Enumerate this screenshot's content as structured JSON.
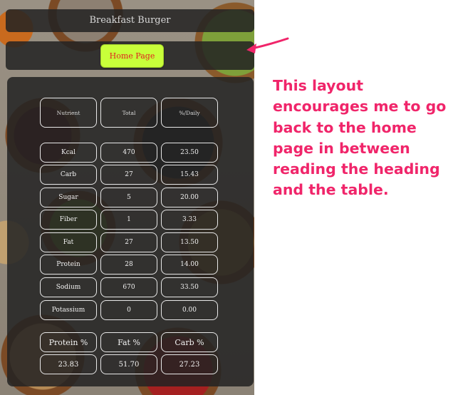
{
  "header": {
    "title": "Breakfast Burger"
  },
  "nav": {
    "home_label": "Home Page"
  },
  "table": {
    "headers": [
      "Nutrient",
      "Total",
      "%/Daily"
    ],
    "rows": [
      [
        "Kcal",
        "470",
        "23.50"
      ],
      [
        "Carb",
        "27",
        "15.43"
      ],
      [
        "Sugar",
        "5",
        "20.00"
      ],
      [
        "Fiber",
        "1",
        "3.33"
      ],
      [
        "Fat",
        "27",
        "13.50"
      ],
      [
        "Protein",
        "28",
        "14.00"
      ],
      [
        "Sodium",
        "670",
        "33.50"
      ],
      [
        "Potassium",
        "0",
        "0.00"
      ]
    ]
  },
  "summary": {
    "headers": [
      "Protein %",
      "Fat %",
      "Carb %"
    ],
    "values": [
      "23.83",
      "51.70",
      "27.23"
    ]
  },
  "annotation": {
    "text": "This layout encourages me to go back to the home page in between reading the heading and the table.",
    "color": "#f0256a"
  },
  "colors": {
    "button_bg": "#c8ff3a",
    "button_text": "#e0241f"
  }
}
